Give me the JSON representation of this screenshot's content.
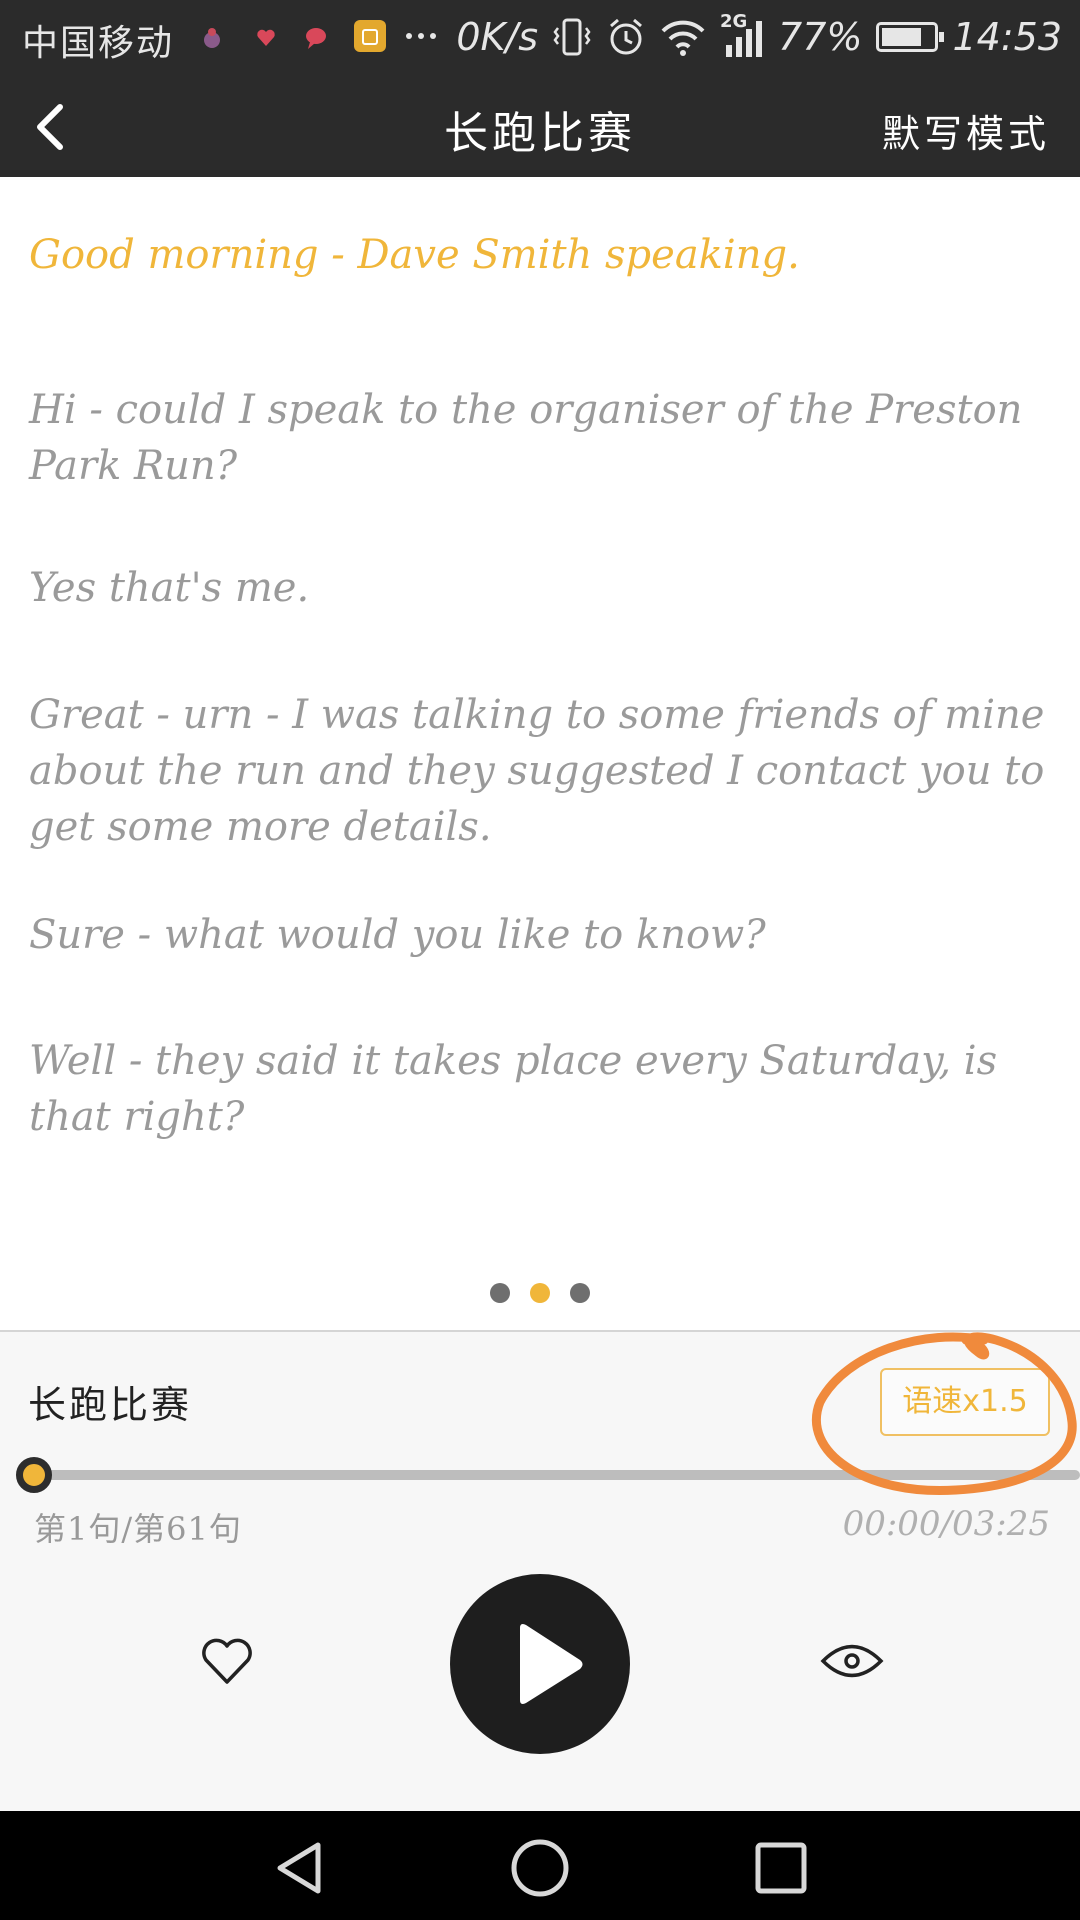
{
  "status_bar": {
    "carrier": "中国移动",
    "net_speed": "0K/s",
    "network_type": "2G",
    "battery": "77%",
    "battery_level": 0.77,
    "time": "14:53"
  },
  "header": {
    "title": "长跑比赛",
    "dictation_label": "默写模式"
  },
  "transcript": {
    "lines": [
      {
        "text": "Good morning - Dave Smith speaking.",
        "active": true
      },
      {
        "text": "Hi - could I speak to the organiser of the Preston Park Run?",
        "active": false
      },
      {
        "text": "Yes that's me.",
        "active": false
      },
      {
        "text": "Great - urn - I was talking to some friends of mine about the run and they suggested I contact you to get some more details.",
        "active": false
      },
      {
        "text": "Sure - what would you like to know?",
        "active": false
      },
      {
        "text": "Well - they said it takes place every Saturday, is that right?",
        "active": false
      }
    ],
    "page_indicator": {
      "count": 3,
      "active_index": 1
    }
  },
  "player": {
    "title": "长跑比赛",
    "speed_label": "语速x1.5",
    "progress": 0,
    "sentence_counter": "第1句/第61句",
    "time": "00:00/03:25"
  },
  "colors": {
    "accent": "#f0b63a",
    "annotation": "#f08a3c",
    "bar_bg": "#2b2b2b",
    "text_muted": "#9a9a9a"
  },
  "icons": {
    "back": "chevron-left-icon",
    "favorite": "heart-icon",
    "play": "play-icon",
    "view": "eye-icon",
    "nav_back": "triangle-back-icon",
    "nav_home": "circle-home-icon",
    "nav_recents": "square-recents-icon"
  }
}
